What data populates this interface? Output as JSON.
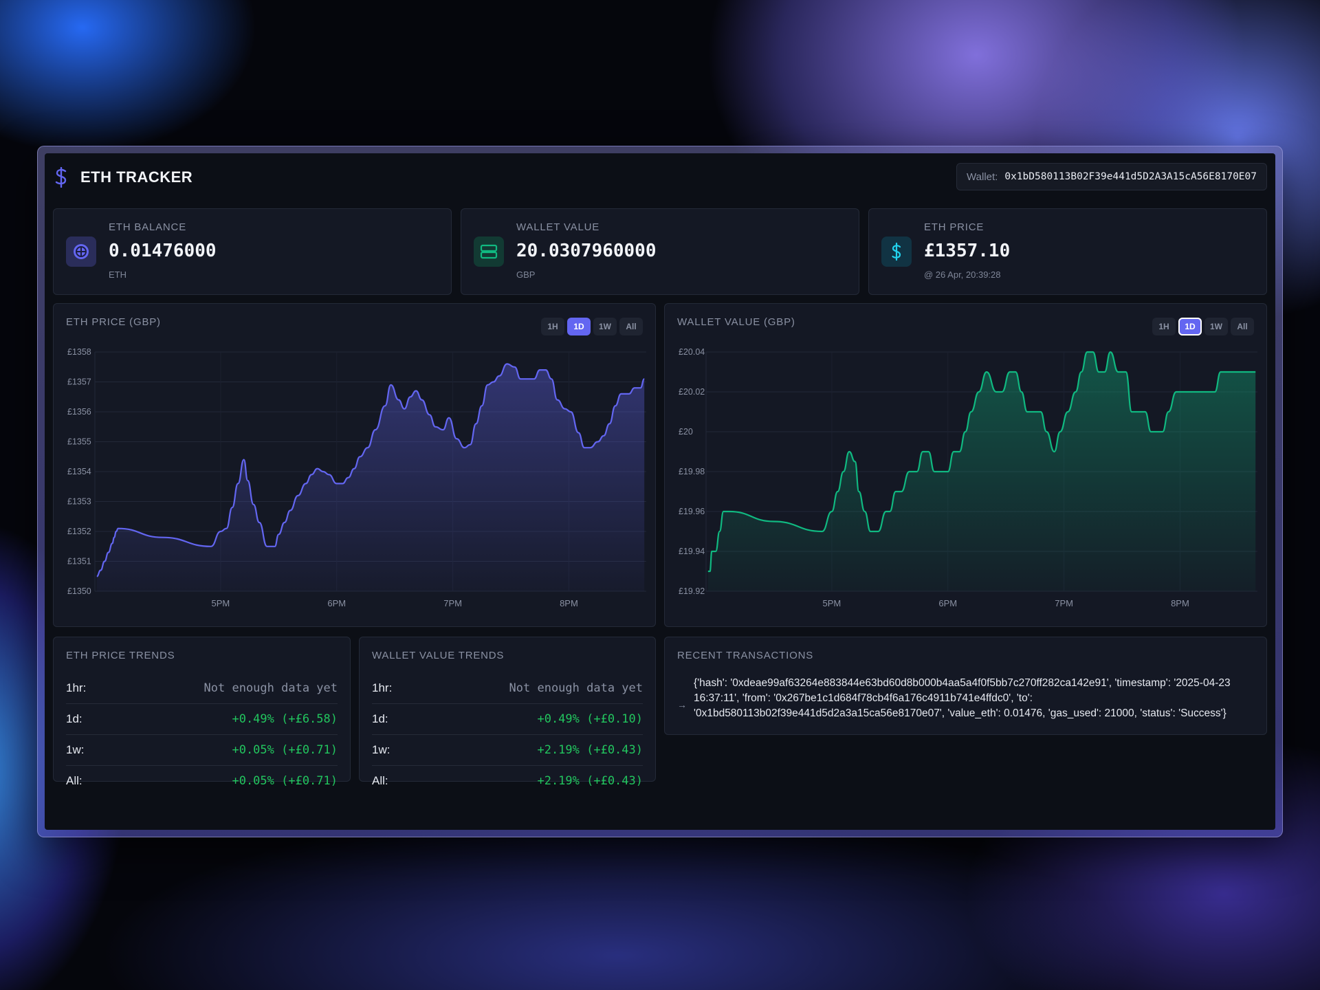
{
  "app": {
    "title": "ETH TRACKER",
    "wallet_label": "Wallet:",
    "wallet_address": "0x1bD580113B02F39e441d5D2A3A15cA56E8170E07"
  },
  "stats": [
    {
      "label": "ETH BALANCE",
      "value": "0.01476000",
      "sub": "ETH",
      "icon": "eth-coin-icon",
      "color": "#6366f1"
    },
    {
      "label": "WALLET VALUE",
      "value": "20.0307960000",
      "sub": "GBP",
      "icon": "wallet-icon",
      "color": "#10b981"
    },
    {
      "label": "ETH PRICE",
      "value": "£1357.10",
      "sub": "@ 26 Apr, 20:39:28",
      "icon": "dollar-icon",
      "color": "#22d3ee"
    }
  ],
  "range_buttons": [
    "1H",
    "1D",
    "1W",
    "All"
  ],
  "charts": {
    "eth_price": {
      "title": "ETH PRICE (GBP)",
      "active_range": "1D"
    },
    "wallet_value": {
      "title": "WALLET VALUE (GBP)",
      "active_range": "1D"
    }
  },
  "chart_data": [
    {
      "type": "area",
      "title": "ETH PRICE (GBP)",
      "color": "#6366f1",
      "y_tick_labels": [
        "£1358",
        "£1357",
        "£1356",
        "£1355",
        "£1354",
        "£1353",
        "£1352",
        "£1351",
        "£1350"
      ],
      "x_tick_labels": [
        "5PM",
        "6PM",
        "7PM",
        "8PM"
      ],
      "ylim": [
        1350,
        1358
      ],
      "y_ticks": [
        1358,
        1357,
        1356,
        1355,
        1354,
        1353,
        1352,
        1351,
        1350
      ],
      "x_ticks": [
        "17:00",
        "18:00",
        "19:00",
        "20:00"
      ],
      "xlim": [
        "15:55",
        "20:40"
      ],
      "grid": true,
      "x": [
        "15:56",
        "15:58",
        "16:00",
        "16:02",
        "16:04",
        "16:05",
        "16:06",
        "16:07",
        "16:30",
        "16:55",
        "17:00",
        "17:03",
        "17:06",
        "17:09",
        "17:12",
        "17:14",
        "17:17",
        "17:20",
        "17:24",
        "17:28",
        "17:30",
        "17:33",
        "17:36",
        "17:40",
        "17:44",
        "17:47",
        "17:50",
        "17:53",
        "17:56",
        "18:00",
        "18:03",
        "18:06",
        "18:09",
        "18:12",
        "18:16",
        "18:20",
        "18:25",
        "18:28",
        "18:32",
        "18:35",
        "18:38",
        "18:41",
        "18:44",
        "18:48",
        "18:51",
        "18:55",
        "18:58",
        "19:02",
        "19:06",
        "19:09",
        "19:12",
        "19:15",
        "19:18",
        "19:21",
        "19:24",
        "19:28",
        "19:32",
        "19:35",
        "19:38",
        "19:42",
        "19:45",
        "19:48",
        "19:51",
        "19:54",
        "19:58",
        "20:01",
        "20:05",
        "20:08",
        "20:11",
        "20:15",
        "20:18",
        "20:21",
        "20:24",
        "20:27",
        "20:31",
        "20:34",
        "20:37",
        "20:39"
      ],
      "values": [
        1350.5,
        1350.7,
        1351.0,
        1351.3,
        1351.6,
        1351.8,
        1352.0,
        1352.1,
        1351.8,
        1351.5,
        1352.0,
        1352.1,
        1352.8,
        1353.6,
        1354.4,
        1353.7,
        1352.9,
        1352.3,
        1351.5,
        1351.5,
        1351.9,
        1352.3,
        1352.7,
        1353.2,
        1353.6,
        1353.9,
        1354.1,
        1354.0,
        1353.9,
        1353.6,
        1353.6,
        1353.8,
        1354.1,
        1354.5,
        1354.8,
        1355.4,
        1356.2,
        1356.9,
        1356.4,
        1356.1,
        1356.5,
        1356.7,
        1356.4,
        1355.9,
        1355.5,
        1355.4,
        1355.8,
        1355.1,
        1354.8,
        1354.9,
        1355.6,
        1356.2,
        1356.9,
        1357.0,
        1357.2,
        1357.6,
        1357.5,
        1357.1,
        1357.1,
        1357.1,
        1357.4,
        1357.4,
        1357.1,
        1356.4,
        1356.1,
        1356.0,
        1355.3,
        1354.8,
        1354.8,
        1355.0,
        1355.2,
        1355.6,
        1356.2,
        1356.6,
        1356.6,
        1356.8,
        1356.8,
        1357.1
      ]
    },
    {
      "type": "area",
      "title": "WALLET VALUE (GBP)",
      "color": "#10b981",
      "y_tick_labels": [
        "£20.04",
        "£20.02",
        "£20",
        "£19.98",
        "£19.96",
        "£19.94",
        "£19.92"
      ],
      "x_tick_labels": [
        "5PM",
        "6PM",
        "7PM",
        "8PM"
      ],
      "ylim": [
        19.92,
        20.04
      ],
      "y_ticks": [
        20.04,
        20.02,
        20.0,
        19.98,
        19.96,
        19.94,
        19.92
      ],
      "x_ticks": [
        "17:00",
        "18:00",
        "19:00",
        "20:00"
      ],
      "xlim": [
        "15:55",
        "20:40"
      ],
      "grid": true,
      "x": [
        "15:56",
        "15:57",
        "15:58",
        "15:59",
        "16:00",
        "16:02",
        "16:04",
        "16:05",
        "16:06",
        "16:07",
        "16:30",
        "16:55",
        "17:00",
        "17:03",
        "17:06",
        "17:09",
        "17:12",
        "17:14",
        "17:17",
        "17:20",
        "17:24",
        "17:28",
        "17:30",
        "17:33",
        "17:36",
        "17:40",
        "17:44",
        "17:47",
        "17:50",
        "17:53",
        "17:56",
        "18:00",
        "18:03",
        "18:06",
        "18:09",
        "18:12",
        "18:16",
        "18:20",
        "18:25",
        "18:28",
        "18:32",
        "18:35",
        "18:38",
        "18:41",
        "18:44",
        "18:48",
        "18:51",
        "18:55",
        "18:58",
        "19:02",
        "19:06",
        "19:09",
        "19:12",
        "19:15",
        "19:18",
        "19:21",
        "19:24",
        "19:28",
        "19:32",
        "19:35",
        "19:38",
        "19:42",
        "19:45",
        "19:48",
        "19:51",
        "19:54",
        "19:58",
        "20:01",
        "20:05",
        "20:08",
        "20:11",
        "20:15",
        "20:18",
        "20:21",
        "20:24",
        "20:27",
        "20:31",
        "20:34",
        "20:37",
        "20:39"
      ],
      "values": [
        19.93,
        19.93,
        19.94,
        19.94,
        19.94,
        19.95,
        19.96,
        19.96,
        19.96,
        19.96,
        19.955,
        19.95,
        19.96,
        19.97,
        19.98,
        19.99,
        19.985,
        19.97,
        19.96,
        19.95,
        19.95,
        19.96,
        19.96,
        19.97,
        19.97,
        19.98,
        19.98,
        19.99,
        19.99,
        19.98,
        19.98,
        19.98,
        19.99,
        19.99,
        20.0,
        20.01,
        20.02,
        20.03,
        20.02,
        20.02,
        20.03,
        20.03,
        20.02,
        20.01,
        20.01,
        20.01,
        20.0,
        19.99,
        20.0,
        20.01,
        20.02,
        20.03,
        20.04,
        20.04,
        20.03,
        20.03,
        20.04,
        20.03,
        20.03,
        20.01,
        20.01,
        20.01,
        20.0,
        20.0,
        20.0,
        20.01,
        20.02,
        20.02,
        20.02,
        20.02,
        20.02,
        20.02,
        20.02,
        20.03,
        20.03,
        20.03,
        20.03,
        20.03,
        20.03,
        20.03
      ]
    }
  ],
  "eth_trends": {
    "title": "ETH PRICE TRENDS",
    "rows": [
      {
        "key": "1hr:",
        "value": "Not enough data yet"
      },
      {
        "key": "1d:",
        "value": "+0.49% (+£6.58)"
      },
      {
        "key": "1w:",
        "value": "+0.05% (+£0.71)"
      },
      {
        "key": "All:",
        "value": "+0.05% (+£0.71)"
      }
    ]
  },
  "wallet_trends": {
    "title": "WALLET VALUE TRENDS",
    "rows": [
      {
        "key": "1hr:",
        "value": "Not enough data yet"
      },
      {
        "key": "1d:",
        "value": "+0.49% (+£0.10)"
      },
      {
        "key": "1w:",
        "value": "+2.19% (+£0.43)"
      },
      {
        "key": "All:",
        "value": "+2.19% (+£0.43)"
      }
    ]
  },
  "transactions": {
    "title": "RECENT TRANSACTIONS",
    "items": [
      "{'hash': '0xdeae99af63264e883844e63bd60d8b000b4aa5a4f0f5bb7c270ff282ca142e91', 'timestamp': '2025-04-23 16:37:11', 'from': '0x267be1c1d684f78cb4f6a176c4911b741e4ffdc0', 'to': '0x1bd580113b02f39e441d5d2a3a15ca56e8170e07', 'value_eth': 0.01476, 'gas_used': 21000, 'status': 'Success'}"
    ]
  }
}
